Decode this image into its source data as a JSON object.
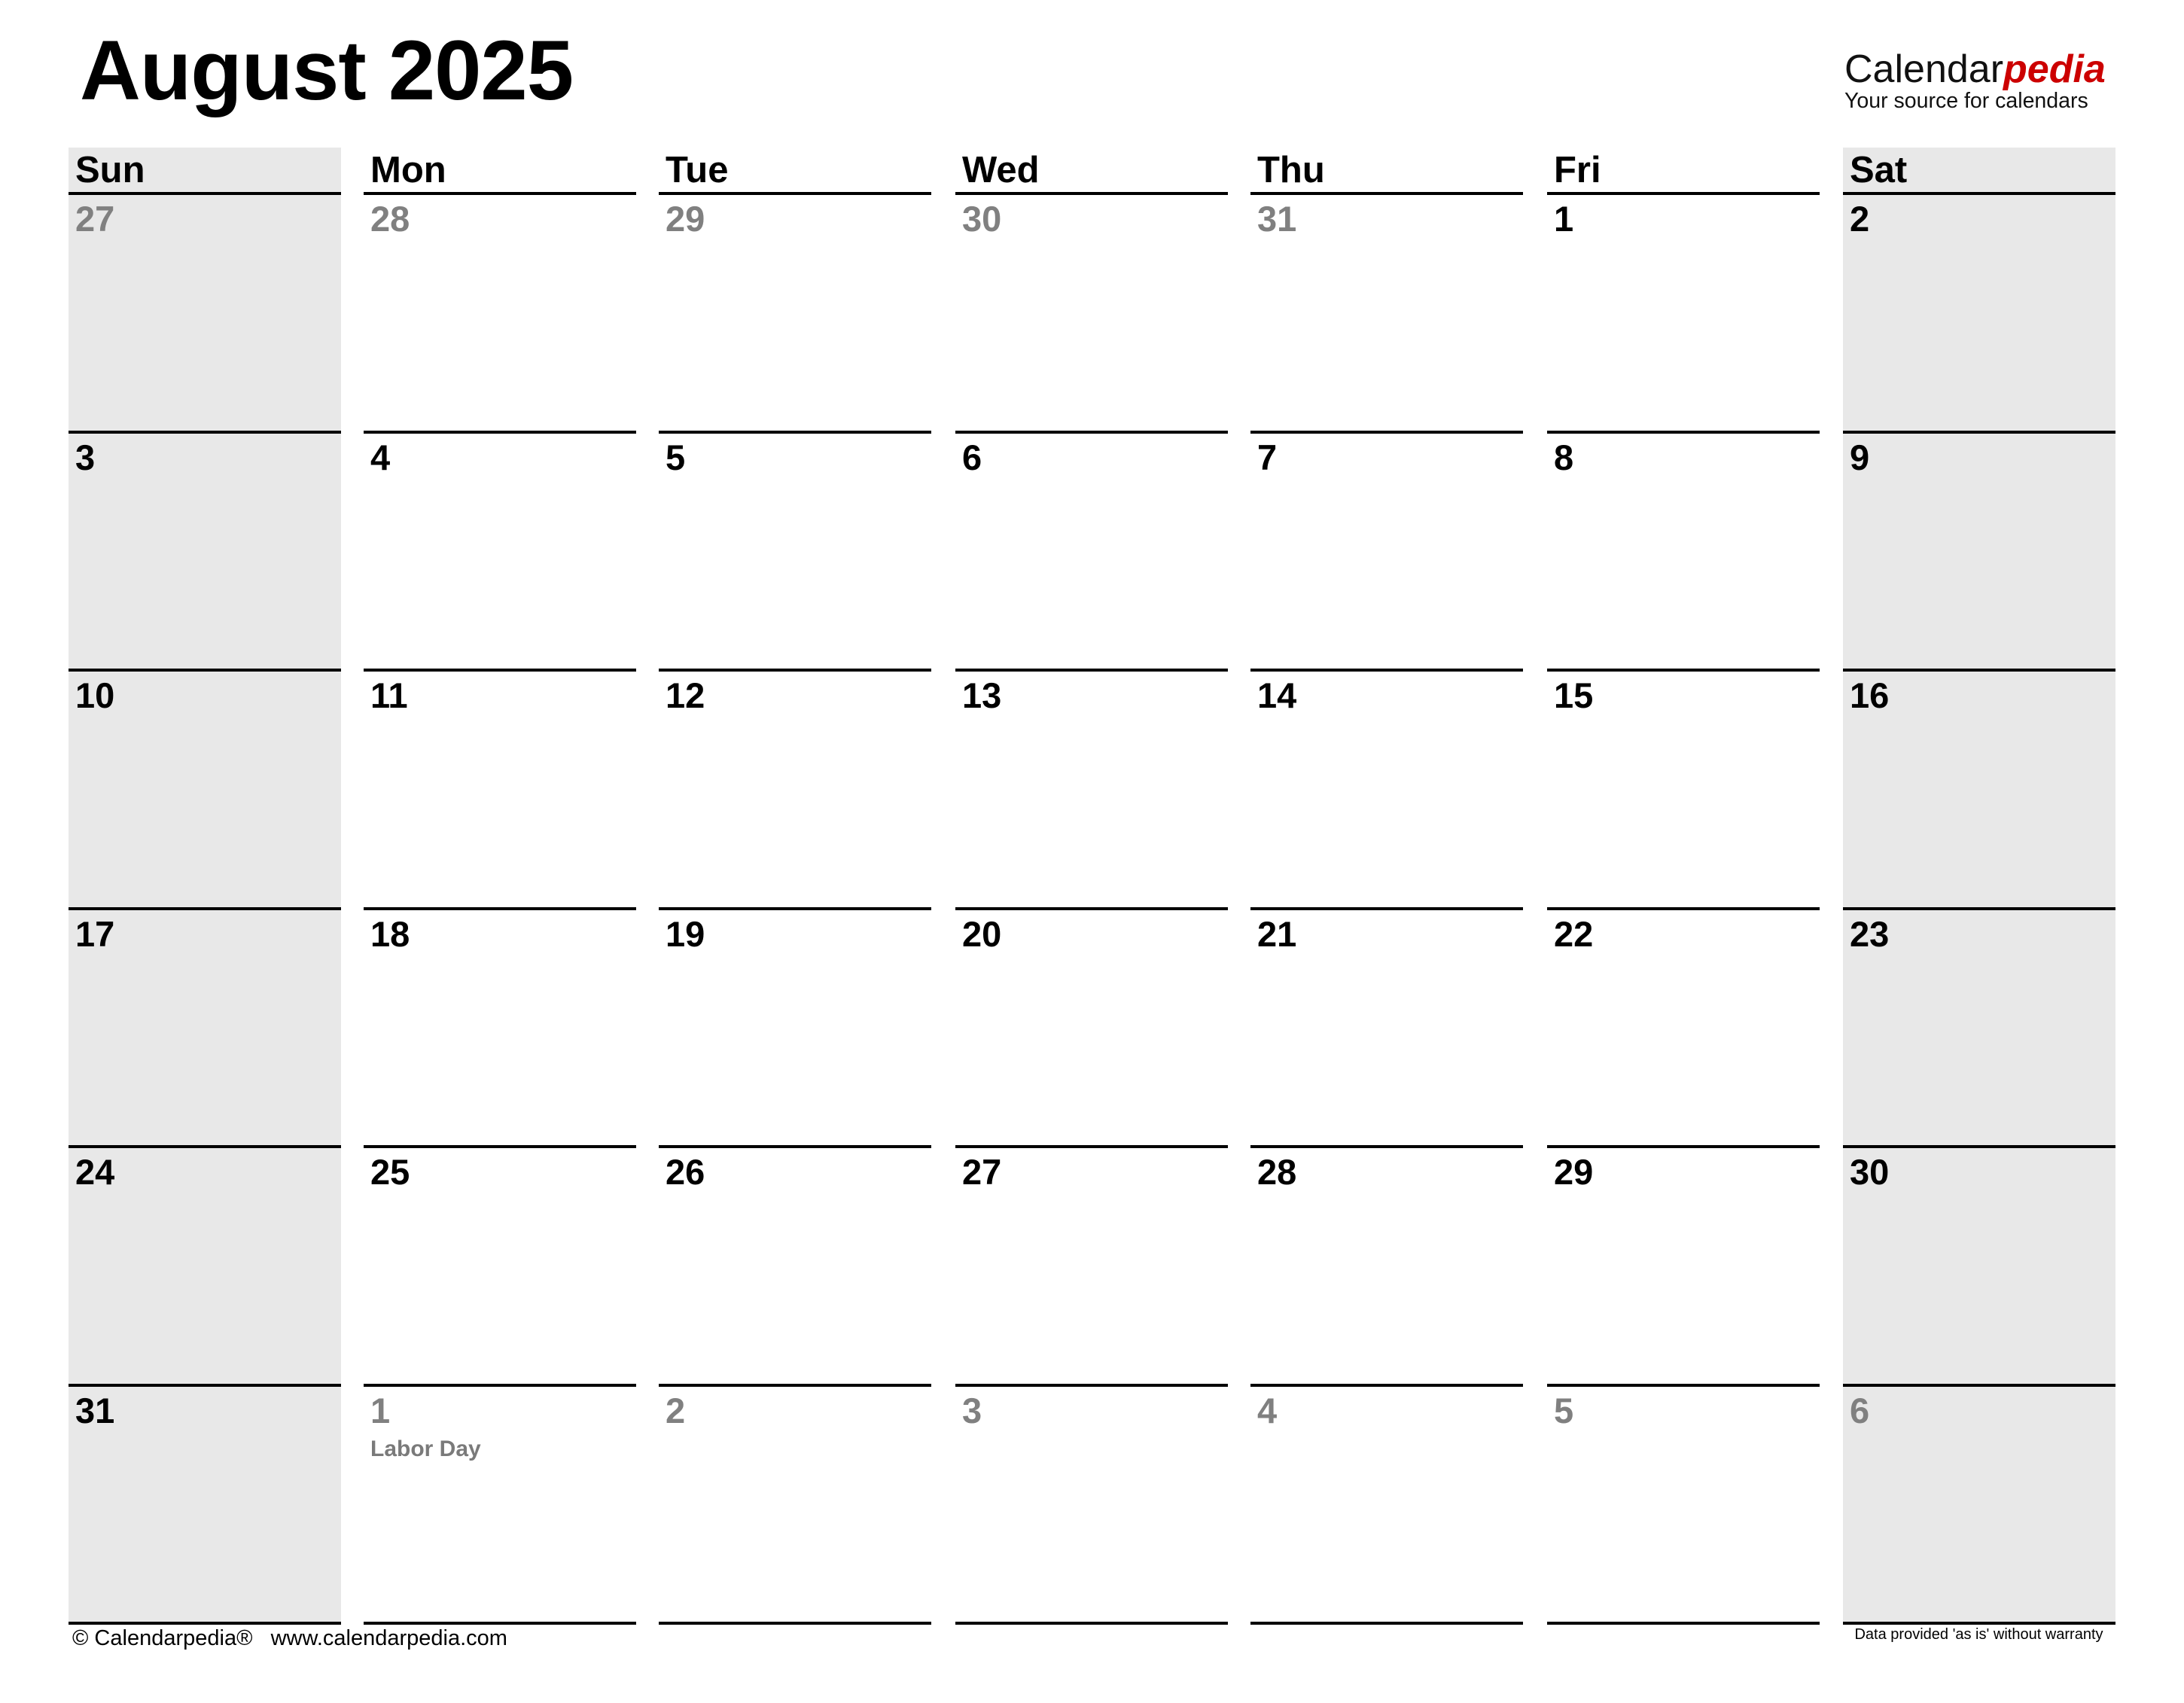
{
  "title": "August 2025",
  "logo": {
    "brand_part1": "Calendar",
    "brand_part2": "pedia",
    "tagline": "Your source for calendars",
    "accent_color": "#cc0000"
  },
  "weekdays": [
    "Sun",
    "Mon",
    "Tue",
    "Wed",
    "Thu",
    "Fri",
    "Sat"
  ],
  "weekend_shade_color": "#e8e8e8",
  "weeks": [
    [
      {
        "day": "27",
        "current": false
      },
      {
        "day": "28",
        "current": false
      },
      {
        "day": "29",
        "current": false
      },
      {
        "day": "30",
        "current": false
      },
      {
        "day": "31",
        "current": false
      },
      {
        "day": "1",
        "current": true
      },
      {
        "day": "2",
        "current": true
      }
    ],
    [
      {
        "day": "3",
        "current": true
      },
      {
        "day": "4",
        "current": true
      },
      {
        "day": "5",
        "current": true
      },
      {
        "day": "6",
        "current": true
      },
      {
        "day": "7",
        "current": true
      },
      {
        "day": "8",
        "current": true
      },
      {
        "day": "9",
        "current": true
      }
    ],
    [
      {
        "day": "10",
        "current": true
      },
      {
        "day": "11",
        "current": true
      },
      {
        "day": "12",
        "current": true
      },
      {
        "day": "13",
        "current": true
      },
      {
        "day": "14",
        "current": true
      },
      {
        "day": "15",
        "current": true
      },
      {
        "day": "16",
        "current": true
      }
    ],
    [
      {
        "day": "17",
        "current": true
      },
      {
        "day": "18",
        "current": true
      },
      {
        "day": "19",
        "current": true
      },
      {
        "day": "20",
        "current": true
      },
      {
        "day": "21",
        "current": true
      },
      {
        "day": "22",
        "current": true
      },
      {
        "day": "23",
        "current": true
      }
    ],
    [
      {
        "day": "24",
        "current": true
      },
      {
        "day": "25",
        "current": true
      },
      {
        "day": "26",
        "current": true
      },
      {
        "day": "27",
        "current": true
      },
      {
        "day": "28",
        "current": true
      },
      {
        "day": "29",
        "current": true
      },
      {
        "day": "30",
        "current": true
      }
    ],
    [
      {
        "day": "31",
        "current": true
      },
      {
        "day": "1",
        "current": false,
        "holiday": "Labor Day"
      },
      {
        "day": "2",
        "current": false
      },
      {
        "day": "3",
        "current": false
      },
      {
        "day": "4",
        "current": false
      },
      {
        "day": "5",
        "current": false
      },
      {
        "day": "6",
        "current": false
      }
    ]
  ],
  "footer": {
    "copyright": "© Calendarpedia®",
    "website": "www.calendarpedia.com",
    "disclaimer": "Data provided 'as is' without warranty"
  }
}
